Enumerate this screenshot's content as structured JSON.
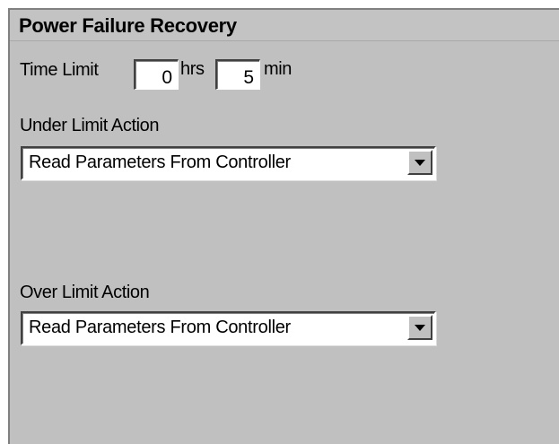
{
  "panel": {
    "title": "Power Failure Recovery"
  },
  "time_limit": {
    "label": "Time Limit",
    "hours_value": "0",
    "hours_unit": "hrs",
    "minutes_value": "5",
    "minutes_unit": "min"
  },
  "under_limit": {
    "label": "Under Limit Action",
    "selected": "Read Parameters From Controller"
  },
  "over_limit": {
    "label": "Over Limit Action",
    "selected": "Read Parameters From Controller"
  },
  "icons": {
    "dropdown_arrow": "chevron-down-icon"
  }
}
